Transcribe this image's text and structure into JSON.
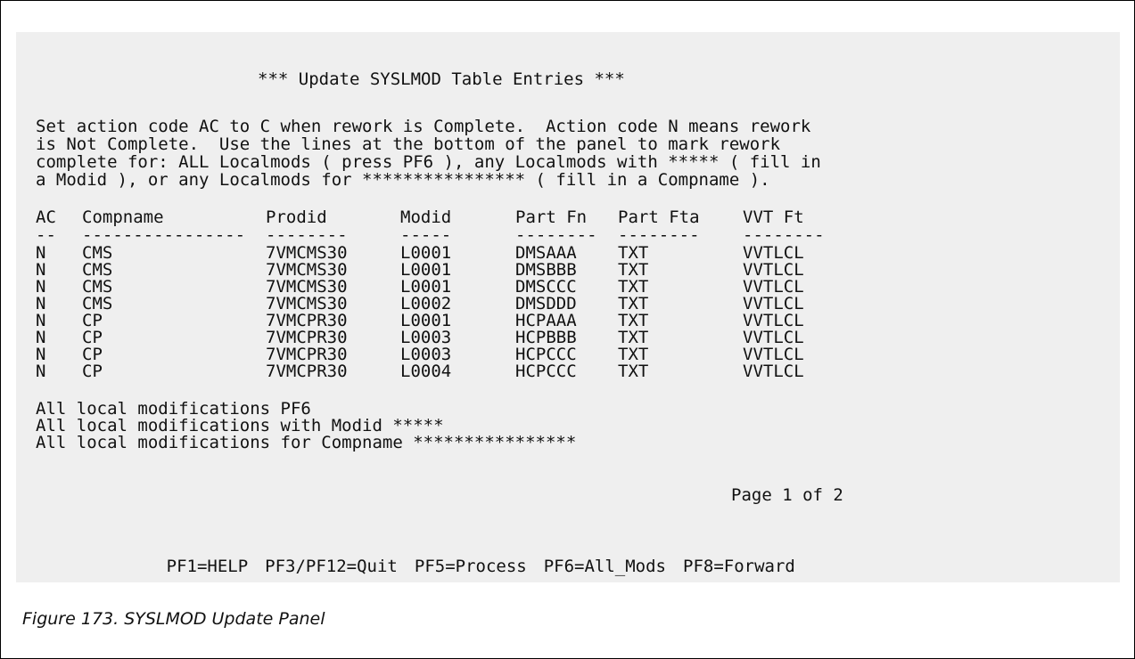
{
  "panel": {
    "title": "*** Update SYSLMOD Table Entries ***",
    "intro_lines": [
      "Set action code AC to C when rework is Complete.  Action code N means rework",
      "is Not Complete.  Use the lines at the bottom of the panel to mark rework",
      "complete for: ALL Localmods ( press PF6 ), any Localmods with ***** ( fill in",
      "a Modid ), or any Localmods for **************** ( fill in a Compname )."
    ],
    "headers": {
      "ac": "AC",
      "compname": "Compname",
      "prodid": "Prodid",
      "modid": "Modid",
      "part_fn": "Part Fn",
      "part_fta": "Part Fta",
      "vvt_ft": "VVT Ft"
    },
    "separators": {
      "ac": "--",
      "compname": "----------------",
      "prodid": "--------",
      "modid": "-----",
      "part_fn": "--------",
      "part_fta": "--------",
      "vvt_ft": "--------"
    },
    "rows": [
      {
        "ac": "N",
        "compname": "CMS",
        "prodid": "7VMCMS30",
        "modid": "L0001",
        "part_fn": "DMSAAA",
        "part_fta": "TXT",
        "vvt_ft": "VVTLCL"
      },
      {
        "ac": "N",
        "compname": "CMS",
        "prodid": "7VMCMS30",
        "modid": "L0001",
        "part_fn": "DMSBBB",
        "part_fta": "TXT",
        "vvt_ft": "VVTLCL"
      },
      {
        "ac": "N",
        "compname": "CMS",
        "prodid": "7VMCMS30",
        "modid": "L0001",
        "part_fn": "DMSCCC",
        "part_fta": "TXT",
        "vvt_ft": "VVTLCL"
      },
      {
        "ac": "N",
        "compname": "CMS",
        "prodid": "7VMCMS30",
        "modid": "L0002",
        "part_fn": "DMSDDD",
        "part_fta": "TXT",
        "vvt_ft": "VVTLCL"
      },
      {
        "ac": "N",
        "compname": "CP",
        "prodid": "7VMCPR30",
        "modid": "L0001",
        "part_fn": "HCPAAA",
        "part_fta": "TXT",
        "vvt_ft": "VVTLCL"
      },
      {
        "ac": "N",
        "compname": "CP",
        "prodid": "7VMCPR30",
        "modid": "L0003",
        "part_fn": "HCPBBB",
        "part_fta": "TXT",
        "vvt_ft": "VVTLCL"
      },
      {
        "ac": "N",
        "compname": "CP",
        "prodid": "7VMCPR30",
        "modid": "L0003",
        "part_fn": "HCPCCC",
        "part_fta": "TXT",
        "vvt_ft": "VVTLCL"
      },
      {
        "ac": "N",
        "compname": "CP",
        "prodid": "7VMCPR30",
        "modid": "L0004",
        "part_fn": "HCPCCC",
        "part_fta": "TXT",
        "vvt_ft": "VVTLCL"
      }
    ],
    "bottom_lines": {
      "all_pf6": "All local modifications PF6",
      "with_modid": "All local modifications with Modid *****",
      "for_compname": "All local modifications for Compname ****************"
    },
    "page_indicator": "Page 1 of 2",
    "pf_keys": [
      "PF1=HELP",
      "PF3/PF12=Quit",
      "PF5=Process",
      "PF6=All_Mods",
      "PF8=Forward"
    ]
  },
  "caption": "Figure 173. SYSLMOD Update Panel"
}
